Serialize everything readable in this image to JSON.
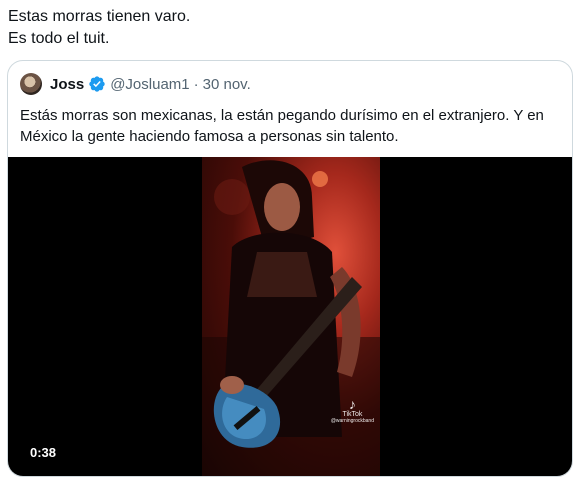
{
  "tweet": {
    "line1": "Estas morras tienen varo.",
    "line2": "Es todo el tuit."
  },
  "quote": {
    "author_name": "Joss",
    "handle": "@Josluam1",
    "separator": "·",
    "date": "30 nov.",
    "text": "Estás morras son mexicanas, la están pegando durísimo en el extranjero. Y en México la gente haciendo famosa a personas sin talento.",
    "verified_color": "#1d9bf0"
  },
  "media": {
    "duration": "0:38",
    "watermark_app": "TikTok",
    "watermark_user": "@warningrockband"
  },
  "colors": {
    "text": "#0f1419",
    "secondary": "#536471",
    "border": "#cfd9de"
  }
}
